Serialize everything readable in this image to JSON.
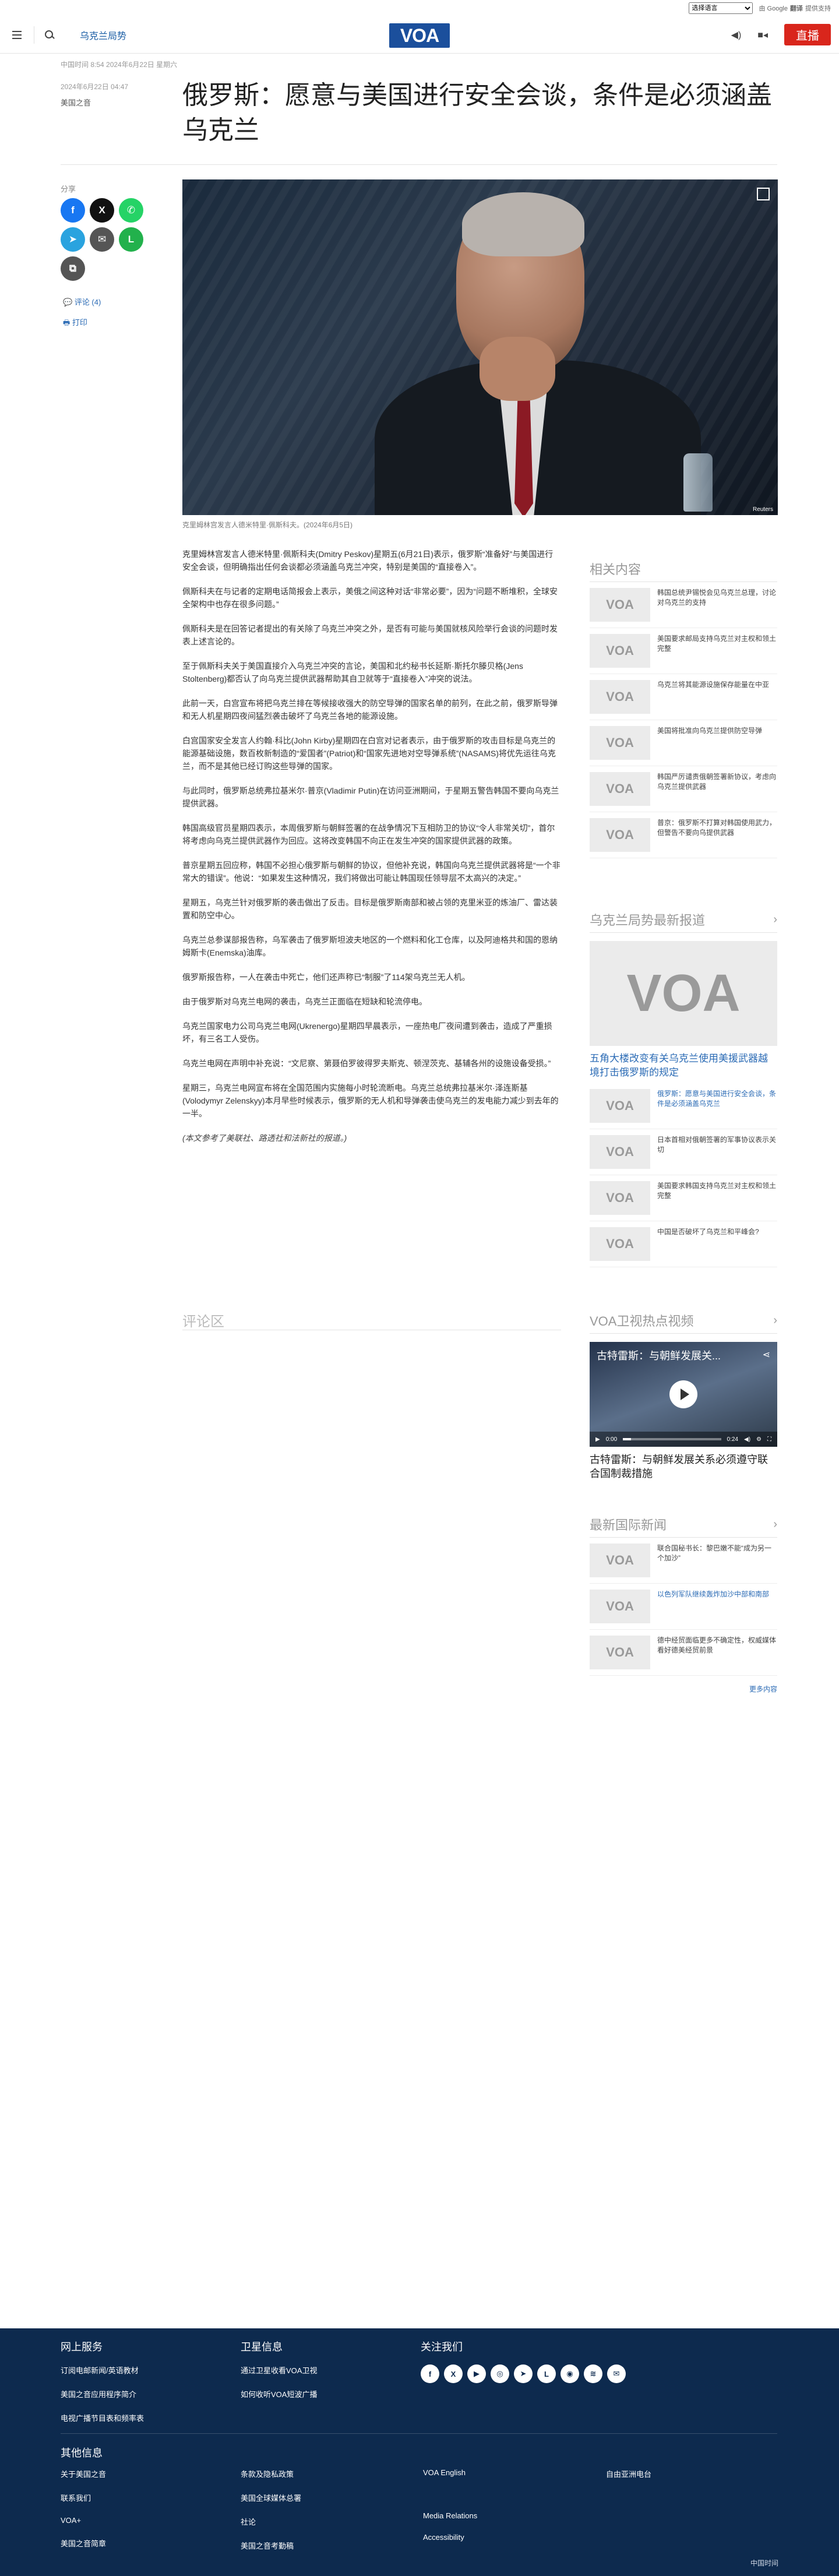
{
  "util": {
    "language_select": "选择语言",
    "gt_label": "由 Google",
    "gt_brand": "翻译",
    "gt_text": "提供支持"
  },
  "header": {
    "section_link": "乌克兰局势",
    "logo": "VOA",
    "live_label": "直播"
  },
  "article": {
    "dateline": "中国时间 8:54 2024年6月22日 星期六",
    "dateline_sub": "2024年6月22日 04:47",
    "author": "美国之音",
    "title": "俄罗斯：愿意与美国进行安全会谈，条件是必须涵盖乌克兰",
    "share_label": "分享",
    "comments_link": "评论 (4)",
    "print_link": "打印",
    "image_credit": "Reuters",
    "caption": "克里姆林宫发言人德米特里·佩斯科夫。(2024年6月5日)",
    "paragraphs": [
      "克里姆林宫发言人德米特里·佩斯科夫(Dmitry Peskov)星期五(6月21日)表示，俄罗斯“准备好”与美国进行安全会谈，但明确指出任何会谈都必须涵盖乌克兰冲突，特别是美国的“直接卷入”。",
      "佩斯科夫在与记者的定期电话简报会上表示，美俄之间这种对话“非常必要”，因为“问题不断堆积，全球安全架构中也存在很多问题。”",
      "佩斯科夫是在回答记者提出的有关除了乌克兰冲突之外，是否有可能与美国就核风险举行会谈的问题时发表上述言论的。",
      "至于佩斯科夫关于美国直接介入乌克兰冲突的言论，美国和北约秘书长延斯·斯托尔滕贝格(Jens Stoltenberg)都否认了向乌克兰提供武器帮助其自卫就等于“直接卷入”冲突的说法。",
      "此前一天，白宫宣布将把乌克兰排在等候接收强大的防空导弹的国家名单的前列，在此之前，俄罗斯导弹和无人机星期四夜间猛烈袭击破坏了乌克兰各地的能源设施。",
      "白宫国家安全发言人约翰·科比(John Kirby)星期四在白宫对记者表示，由于俄罗斯的攻击目标是乌克兰的能源基础设施，数百枚新制造的“爱国者”(Patriot)和“国家先进地对空导弹系统”(NASAMS)将优先运往乌克兰，而不是其他已经订购这些导弹的国家。",
      "与此同时，俄罗斯总统弗拉基米尔·普京(Vladimir Putin)在访问亚洲期间，于星期五警告韩国不要向乌克兰提供武器。",
      "韩国高级官员星期四表示，本周俄罗斯与朝鲜签署的在战争情况下互相防卫的协议“令人非常关切”，首尔将考虑向乌克兰提供武器作为回应。这将改变韩国不向正在发生冲突的国家提供武器的政策。",
      "普京星期五回应称，韩国不必担心俄罗斯与朝鲜的协议，但他补充说，韩国向乌克兰提供武器将是“一个非常大的错误”。他说：“如果发生这种情况，我们将做出可能让韩国现任领导层不太高兴的决定。”",
      "星期五，乌克兰针对俄罗斯的袭击做出了反击。目标是俄罗斯南部和被占领的克里米亚的炼油厂、雷达装置和防空中心。",
      "乌克兰总参谋部报告称，乌军袭击了俄罗斯坦波夫地区的一个燃料和化工仓库，以及阿迪格共和国的恩纳姆斯卡(Enemska)油库。",
      "俄罗斯报告称，一人在袭击中死亡，他们还声称已“制服”了114架乌克兰无人机。",
      "由于俄罗斯对乌克兰电网的袭击，乌克兰正面临在短缺和轮流停电。",
      "乌克兰国家电力公司乌克兰电网(Ukrenergo)星期四早晨表示，一座热电厂夜间遭到袭击，造成了严重损坏，有三名工人受伤。",
      "乌克兰电网在声明中补充说：“文尼察、第聂伯罗彼得罗夫斯克、顿涅茨克、基辅各州的设施设备受损。”",
      "星期三，乌克兰电网宣布将在全国范围内实施每小时轮流断电。乌克兰总统弗拉基米尔·泽连斯基(Volodymyr Zelenskyy)本月早些时候表示，俄罗斯的无人机和导弹袭击使乌克兰的发电能力减少到去年的一半。"
    ],
    "note": "(本文参考了美联社、路透社和法新社的报道。)",
    "comments_title": "评论区"
  },
  "sidebar": {
    "related_title": "相关内容",
    "related": [
      "韩国总统尹锡悦会见乌克兰总理，讨论对乌克兰的支持",
      "美国要求邮局支持乌克兰对主权和领土完整",
      "乌克兰将其能源设施保存能量在中亚",
      "美国将批准向乌克兰提供防空导弹",
      "韩国严厉谴责俄朝签署新协议，考虑向乌克兰提供武器",
      "普京：俄罗斯不打算对韩国使用武力，但警告不要向乌提供武器"
    ],
    "latest_title": "乌克兰局势最新报道",
    "feature_title": "五角大楼改变有关乌克兰使用美援武器越境打击俄罗斯的规定",
    "latest": [
      "俄罗斯：愿意与美国进行安全会谈，条件是必须涵盖乌克兰",
      "日本首相对俄朝签署的军事协议表示关切",
      "美国要求韩国支持乌克兰对主权和领土完整",
      "中国是否破坏了乌克兰和平峰会?"
    ],
    "video_title_head": "VOA卫视热点视频",
    "video_overlay": "古特雷斯：与朝鲜发展关...",
    "video_time_start": "0:00",
    "video_time_end": "0:24",
    "video_progress": 0.08,
    "video_caption": "古特雷斯：与朝鲜发展关系必须遵守联合国制裁措施",
    "intl_title": "最新国际新闻",
    "intl": [
      "联合国秘书长：黎巴嫩不能“成为另一个加沙”",
      "以色列军队继续轰炸加沙中部和南部",
      "德中经贸面临更多不确定性，权威媒体看好德美经贸前景"
    ],
    "more": "更多内容"
  },
  "footer": {
    "col1_title": "网上服务",
    "col1": [
      "订阅电邮新闻/英语教材",
      "美国之音应用程序简介",
      "电视广播节目表和频率表"
    ],
    "col2_title": "卫星信息",
    "col2": [
      "通过卫星收看VOA卫视",
      "如何收听VOA短波广播"
    ],
    "col3_title": "关注我们",
    "other_title": "其他信息",
    "other_a": [
      "关于美国之音",
      "联系我们",
      "VOA+",
      "美国之音简章"
    ],
    "other_b": [
      "条款及隐私政策",
      "美国全球媒体总署",
      "社论",
      "美国之音考勤稿"
    ],
    "other_c": [
      "VOA English",
      "",
      "Media Relations",
      "Accessibility"
    ],
    "other_d": [
      "自由亚洲电台"
    ],
    "bottom": "中国时间"
  },
  "colors": {
    "voa_blue": "#1b4f9c",
    "live_red": "#d9261c",
    "link_blue": "#2b6bb5",
    "footer_bg": "#0d2a4e"
  }
}
